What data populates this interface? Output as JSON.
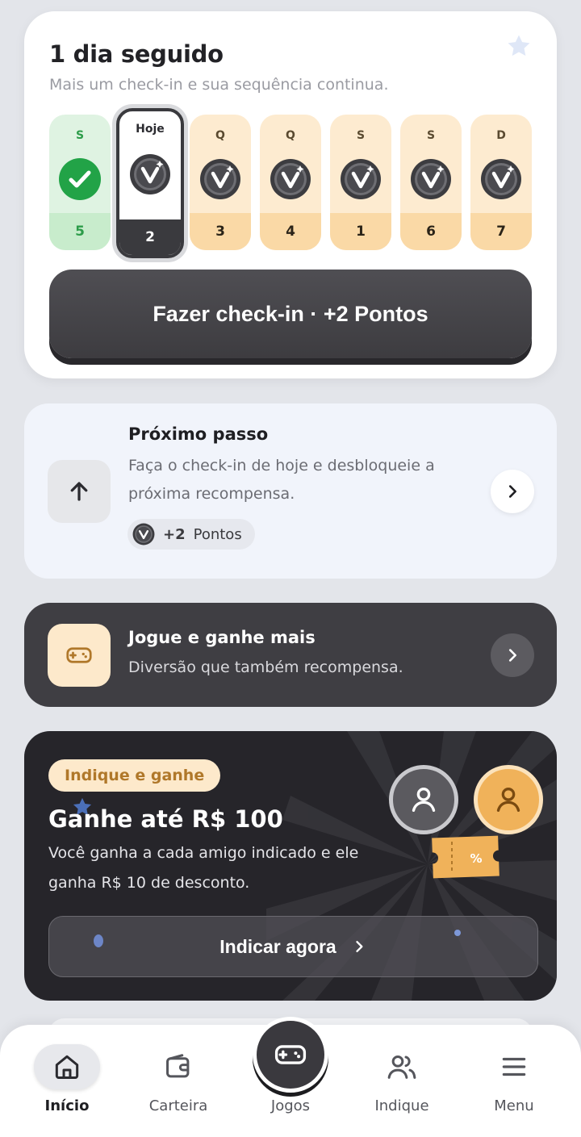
{
  "colors": {
    "accent_dark": "#3a3a3e",
    "success_green": "#22a347",
    "warm_yellow": "#fad9a6",
    "referral_tag": "#fde9cb"
  },
  "checkin": {
    "title": "1 dia seguido",
    "subtitle": "Mais um check-in e sua sequência continua.",
    "days": [
      {
        "letter": "S",
        "value": "5",
        "state": "done",
        "icon": "check-icon"
      },
      {
        "letter": "Hoje",
        "value": "2",
        "state": "today",
        "icon": "coin-icon"
      },
      {
        "letter": "Q",
        "value": "3",
        "state": "upcoming",
        "icon": "coin-icon"
      },
      {
        "letter": "Q",
        "value": "4",
        "state": "upcoming",
        "icon": "coin-icon"
      },
      {
        "letter": "S",
        "value": "1",
        "state": "upcoming",
        "icon": "coin-icon"
      },
      {
        "letter": "S",
        "value": "6",
        "state": "upcoming",
        "icon": "coin-icon"
      },
      {
        "letter": "D",
        "value": "7",
        "state": "upcoming",
        "icon": "coin-icon"
      }
    ],
    "button_label": "Fazer check-in · +2 Pontos"
  },
  "next_step": {
    "title": "Próximo passo",
    "description": "Faça o check-in de hoje e desbloqueie a próxima recompensa.",
    "points_value": "+2",
    "points_label": "Pontos"
  },
  "play": {
    "title": "Jogue e ganhe mais",
    "description": "Diversão que também recompensa."
  },
  "referral": {
    "tag": "Indique e ganhe",
    "title": "Ganhe até R$ 100",
    "description": "Você ganha a cada amigo indicado e ele ganha R$ 10 de desconto.",
    "button_label": "Indicar agora",
    "ticket_label": "%"
  },
  "nav": {
    "items": [
      {
        "label": "Início",
        "icon": "home-icon",
        "active": true
      },
      {
        "label": "Carteira",
        "icon": "wallet-icon",
        "active": false
      },
      {
        "label": "Jogos",
        "icon": "gamepad-icon",
        "active": false
      },
      {
        "label": "Indique",
        "icon": "users-icon",
        "active": false
      },
      {
        "label": "Menu",
        "icon": "menu-icon",
        "active": false
      }
    ]
  }
}
